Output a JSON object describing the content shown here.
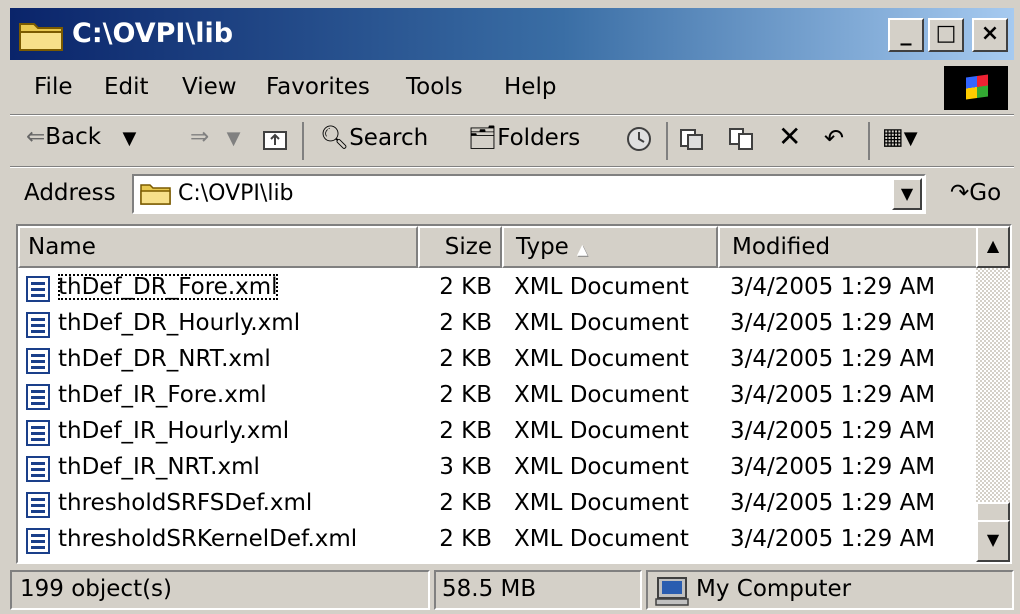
{
  "window": {
    "title": "C:\\OVPI\\lib",
    "minimize_label": "_",
    "maximize_label": "□",
    "close_label": "×"
  },
  "menu": {
    "items": [
      {
        "label": "File"
      },
      {
        "label": "Edit"
      },
      {
        "label": "View"
      },
      {
        "label": "Favorites"
      },
      {
        "label": "Tools"
      },
      {
        "label": "Help"
      }
    ]
  },
  "toolbar": {
    "back_label": "Back",
    "search_label": "Search",
    "folders_label": "Folders"
  },
  "address": {
    "label": "Address",
    "value": "C:\\OVPI\\lib",
    "go_label": "Go"
  },
  "list": {
    "columns": [
      {
        "label": "Name"
      },
      {
        "label": "Size"
      },
      {
        "label": "Type"
      },
      {
        "label": "Modified"
      }
    ],
    "sort_column": "Type",
    "rows": [
      {
        "name": "thDef_DR_Fore.xml",
        "size": "2 KB",
        "type": "XML Document",
        "modified": "3/4/2005 1:29 AM"
      },
      {
        "name": "thDef_DR_Hourly.xml",
        "size": "2 KB",
        "type": "XML Document",
        "modified": "3/4/2005 1:29 AM"
      },
      {
        "name": "thDef_DR_NRT.xml",
        "size": "2 KB",
        "type": "XML Document",
        "modified": "3/4/2005 1:29 AM"
      },
      {
        "name": "thDef_IR_Fore.xml",
        "size": "2 KB",
        "type": "XML Document",
        "modified": "3/4/2005 1:29 AM"
      },
      {
        "name": "thDef_IR_Hourly.xml",
        "size": "2 KB",
        "type": "XML Document",
        "modified": "3/4/2005 1:29 AM"
      },
      {
        "name": "thDef_IR_NRT.xml",
        "size": "3 KB",
        "type": "XML Document",
        "modified": "3/4/2005 1:29 AM"
      },
      {
        "name": "thresholdSRFSDef.xml",
        "size": "2 KB",
        "type": "XML Document",
        "modified": "3/4/2005 1:29 AM"
      },
      {
        "name": "thresholdSRKernelDef.xml",
        "size": "2 KB",
        "type": "XML Document",
        "modified": "3/4/2005 1:29 AM"
      }
    ]
  },
  "status": {
    "objects": "199 object(s)",
    "size": "58.5 MB",
    "zone": "My Computer"
  },
  "colors": {
    "titlebar_start": "#0a246a",
    "titlebar_end": "#a6caf0",
    "face": "#d4d0c8"
  }
}
